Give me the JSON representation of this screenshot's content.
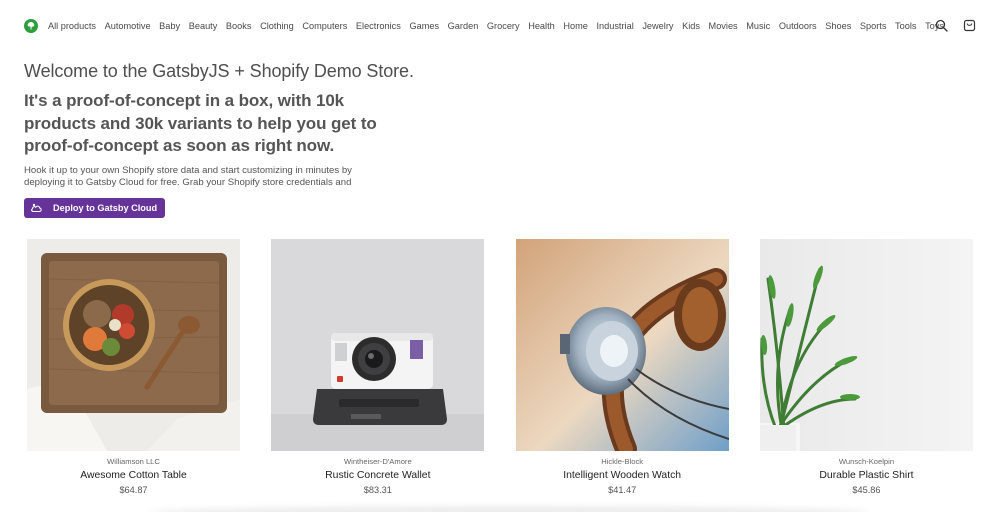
{
  "nav": {
    "items": [
      "All products",
      "Automotive",
      "Baby",
      "Beauty",
      "Books",
      "Clothing",
      "Computers",
      "Electronics",
      "Games",
      "Garden",
      "Grocery",
      "Health",
      "Home",
      "Industrial",
      "Jewelry",
      "Kids",
      "Movies",
      "Music",
      "Outdoors",
      "Shoes",
      "Sports",
      "Tools",
      "Toys"
    ]
  },
  "hero": {
    "title": "Welcome to the GatsbyJS + Shopify Demo Store.",
    "subtitle": "It's a proof-of-concept in a box, with 10k products and 30k variants to help you get to proof-of-concept as soon as right now.",
    "body": "Hook it up to your own Shopify store data and start customizing in minutes by deploying it to Gatsby Cloud for free. Grab your Shopify store credentials and",
    "button_label": "Deploy to Gatsby Cloud"
  },
  "products": [
    {
      "vendor": "Williamson LLC",
      "name": "Awesome Cotton Table",
      "price": "$64.87"
    },
    {
      "vendor": "Wintheiser-D'Amore",
      "name": "Rustic Concrete Wallet",
      "price": "$83.31"
    },
    {
      "vendor": "Hickle-Block",
      "name": "Intelligent Wooden Watch",
      "price": "$41.47"
    },
    {
      "vendor": "Wunsch-Koelpin",
      "name": "Durable Plastic Shirt",
      "price": "$45.86"
    }
  ],
  "colors": {
    "brand": "#663399",
    "logo": "#2e9e3c"
  },
  "icons": {
    "logo": "tree-icon",
    "search": "search-icon",
    "cart": "cart-icon",
    "deploy": "gatsby-cloud-icon"
  }
}
